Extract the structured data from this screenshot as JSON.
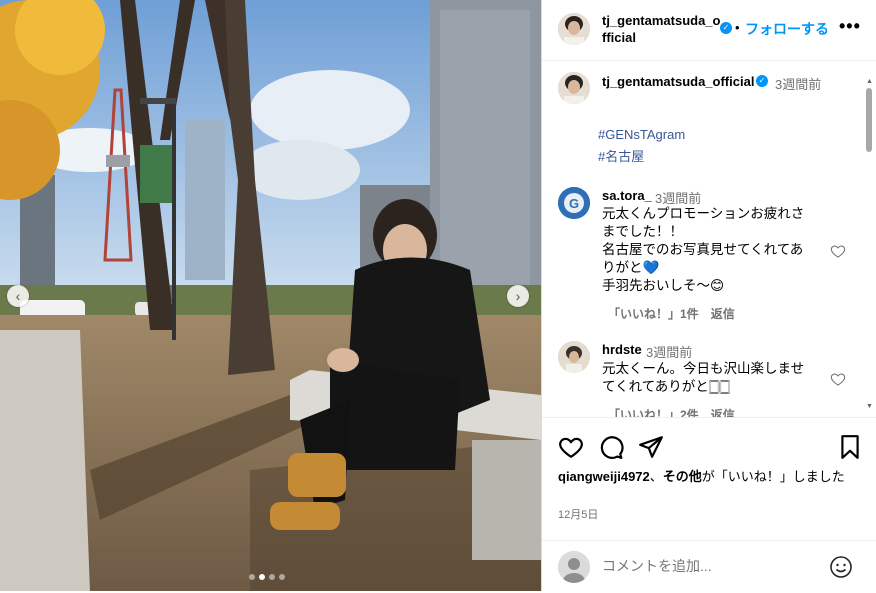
{
  "post": {
    "author": "tj_gentamatsuda_official",
    "follow_label": "フォローする",
    "separator": "•",
    "more_label": "•••",
    "nav_prev": "‹",
    "nav_next": "›"
  },
  "caption": {
    "author": "tj_gentamatsuda_official",
    "time": "3週間前",
    "hashtags": [
      "#GENsTAgram",
      "#名古屋"
    ]
  },
  "comments": [
    {
      "user": "sa.tora_",
      "time": "3週間前",
      "lines": [
        "元太くんプロモーションお疲れさ",
        "までした！！",
        "名古屋でのお写真見せてくれてあ",
        "りがと💙",
        "手羽先おいしそ〜😊"
      ],
      "likes": "「いいね！」1件",
      "reply": "返信"
    },
    {
      "user": "hrdste",
      "time": "3週間前",
      "lines": [
        "元太くーん。今日も沢山楽しませ",
        "てくれてありがと🀆🀆"
      ],
      "likes": "「いいね！」2件",
      "reply": "返信"
    }
  ],
  "likes_line": {
    "user": "qiangweiji4972",
    "sep": "、",
    "others": "その他",
    "rest": "が「いいね！」しました"
  },
  "date": "12月5日",
  "comment_box": {
    "placeholder": "コメントを追加..."
  },
  "icons": {
    "heart": "heart-icon",
    "comment": "comment-icon",
    "share": "share-icon",
    "save": "bookmark-icon",
    "emoji": "emoji-icon"
  },
  "colors": {
    "accent": "#0095f6",
    "hashtag": "#385898",
    "muted": "#737373"
  },
  "carousel": {
    "slide_count": 4,
    "active_index": 1
  }
}
